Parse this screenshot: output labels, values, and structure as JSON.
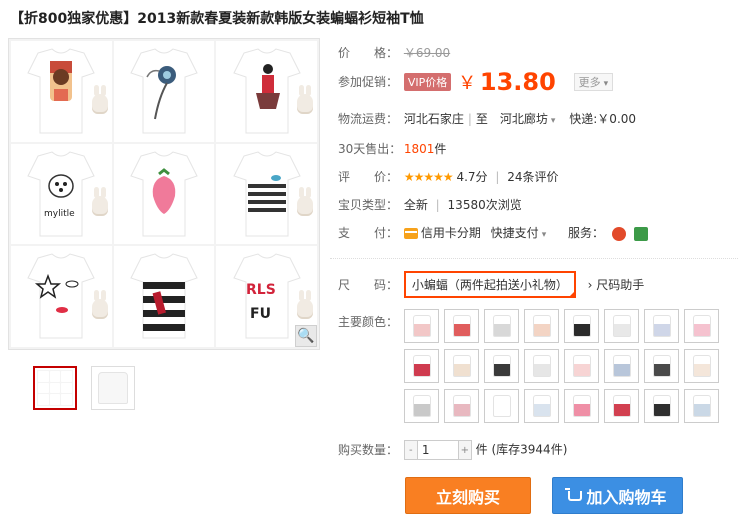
{
  "title": "【折800独家优惠】2013新款春夏装新款韩版女装蝙蝠衫短袖T恤",
  "price": {
    "label": "价　　格：",
    "original": "￥69.00"
  },
  "promo": {
    "label": "参加促销：",
    "badge": "VIP价格",
    "currency": "￥",
    "value": "13.80",
    "more": "更多"
  },
  "shipping": {
    "label": "物流运费：",
    "from": "河北石家庄",
    "to": "至　河北廊坊",
    "express": "快递:￥0.00"
  },
  "sold": {
    "label": "30天售出：",
    "count": "1801",
    "unit": "件"
  },
  "rating": {
    "label": "评　　价：",
    "stars": "★★★★★",
    "score": "4.7分",
    "reviews": "24条评价"
  },
  "condition": {
    "label": "宝贝类型：",
    "type": "全新",
    "views": "13580次浏览"
  },
  "payment": {
    "label": "支　　付：",
    "credit": "信用卡分期",
    "quick": "快捷支付",
    "service_label": "服务："
  },
  "size": {
    "label": "尺　　码：",
    "selected": "小蝙蝠（两件起拍送小礼物）",
    "help": "尺码助手"
  },
  "colors": {
    "label": "主要颜色：",
    "count": 24
  },
  "quantity": {
    "label": "购买数量：",
    "value": "1",
    "stock": "件 (库存3944件)",
    "minus": "-",
    "plus": "+"
  },
  "buttons": {
    "buy": "立刻购买",
    "cart": "加入购物车"
  },
  "icons": {
    "zoom": "magnifier-icon",
    "cart": "cart-icon"
  }
}
